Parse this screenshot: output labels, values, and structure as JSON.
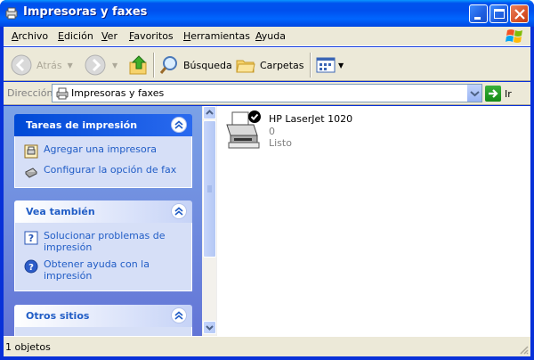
{
  "window": {
    "title": "Impresoras y faxes"
  },
  "menu": [
    {
      "label": "Archivo",
      "accel": "A",
      "rest": "rchivo"
    },
    {
      "label": "Edición",
      "accel": "E",
      "rest": "dición"
    },
    {
      "label": "Ver",
      "accel": "V",
      "rest": "er"
    },
    {
      "label": "Favoritos",
      "accel": "F",
      "rest": "avoritos"
    },
    {
      "label": "Herramientas",
      "accel": "H",
      "rest": "erramientas"
    },
    {
      "label": "Ayuda",
      "accel": "A",
      "rest": "yuda"
    }
  ],
  "toolbar": {
    "back_label": "Atrás",
    "search_label": "Búsqueda",
    "folders_label": "Carpetas"
  },
  "address": {
    "label": "Dirección",
    "value": "Impresoras y faxes",
    "go_label": "Ir"
  },
  "taskpane": {
    "panels": [
      {
        "title": "Tareas de impresión",
        "items": [
          {
            "label": "Agregar una impresora",
            "icon": "add-printer-icon"
          },
          {
            "label": "Configurar la opción de fax",
            "icon": "fax-icon"
          }
        ]
      },
      {
        "title": "Vea también",
        "items": [
          {
            "label": "Solucionar problemas de impresión",
            "icon": "help-troubleshoot-icon"
          },
          {
            "label": "Obtener ayuda con la impresión",
            "icon": "help-icon"
          }
        ]
      },
      {
        "title": "Otros sitios",
        "items": []
      }
    ]
  },
  "printers": [
    {
      "name": "HP LaserJet 1020",
      "documents": "0",
      "status": "Listo",
      "default": true
    }
  ],
  "statusbar": {
    "text": "1 objetos"
  },
  "colors": {
    "titlebar": "#0054e3",
    "taskpane": "#6f8fe0",
    "link": "#215dc6",
    "chrome": "#ece9d8"
  }
}
